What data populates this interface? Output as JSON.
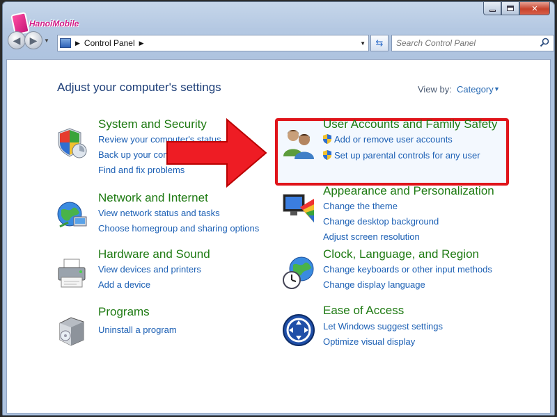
{
  "window": {
    "logo_text": "HanoiMobile",
    "caption": {
      "minimize": "",
      "maximize": "",
      "close": "✕"
    }
  },
  "nav": {
    "breadcrumb": "Control Panel",
    "search_placeholder": "Search Control Panel"
  },
  "header": {
    "title": "Adjust your computer's settings",
    "view_by_label": "View by:",
    "view_by_value": "Category"
  },
  "categories": {
    "system_security": {
      "title": "System and Security",
      "links": [
        "Review your computer's status",
        "Back up your computer",
        "Find and fix problems"
      ]
    },
    "network": {
      "title": "Network and Internet",
      "links": [
        "View network status and tasks",
        "Choose homegroup and sharing options"
      ]
    },
    "hardware": {
      "title": "Hardware and Sound",
      "links": [
        "View devices and printers",
        "Add a device"
      ]
    },
    "programs": {
      "title": "Programs",
      "links": [
        "Uninstall a program"
      ]
    },
    "user_accounts": {
      "title": "User Accounts and Family Safety",
      "links": [
        "Add or remove user accounts",
        "Set up parental controls for any user"
      ]
    },
    "appearance": {
      "title": "Appearance and Personalization",
      "links": [
        "Change the theme",
        "Change desktop background",
        "Adjust screen resolution"
      ]
    },
    "clock": {
      "title": "Clock, Language, and Region",
      "links": [
        "Change keyboards or other input methods",
        "Change display language"
      ]
    },
    "ease": {
      "title": "Ease of Access",
      "links": [
        "Let Windows suggest settings",
        "Optimize visual display"
      ]
    }
  },
  "colors": {
    "category_title": "#1e7a12",
    "link": "#1b5fb4",
    "highlight_annotation": "#e0141a"
  }
}
